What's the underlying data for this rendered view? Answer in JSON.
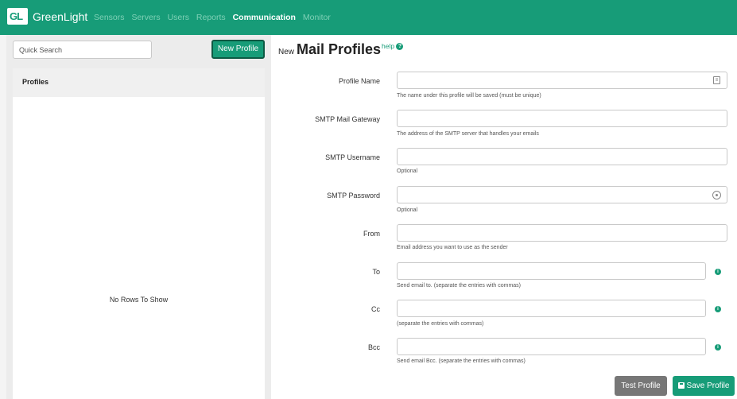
{
  "header": {
    "logo": "GL",
    "brand": "GreenLight",
    "nav": [
      {
        "label": "Sensors",
        "active": false
      },
      {
        "label": "Servers",
        "active": false
      },
      {
        "label": "Users",
        "active": false
      },
      {
        "label": "Reports",
        "active": false
      },
      {
        "label": "Communication",
        "active": true
      },
      {
        "label": "Monitor",
        "active": false
      }
    ]
  },
  "sidebar": {
    "search_placeholder": "Quick Search",
    "new_button": "New Profile",
    "list_header": "Profiles",
    "empty_text": "No Rows To Show"
  },
  "form": {
    "mode": "New",
    "title": "Mail Profiles",
    "help": "help",
    "fields": [
      {
        "label": "Profile Name",
        "value": "",
        "hint": "The name under this profile will be saved (must be unique)"
      },
      {
        "label": "SMTP Mail Gateway",
        "value": "",
        "hint": "The address of the SMTP server that handles your emails"
      },
      {
        "label": "SMTP Username",
        "value": "",
        "hint": "Optional"
      },
      {
        "label": "SMTP Password",
        "value": "",
        "hint": "Optional"
      },
      {
        "label": "From",
        "value": "",
        "hint": "Email address you want to use as the sender"
      },
      {
        "label": "To",
        "value": "",
        "hint": "Send email to. (separate the entries with commas)"
      },
      {
        "label": "Cc",
        "value": "",
        "hint": "(separate the entries with commas)"
      },
      {
        "label": "Bcc",
        "value": "",
        "hint": "Send email Bcc. (separate the entries with commas)"
      }
    ],
    "test_button": "Test Profile",
    "save_button": "Save Profile"
  },
  "colors": {
    "brand": "#179c78",
    "test_button": "#777777"
  }
}
